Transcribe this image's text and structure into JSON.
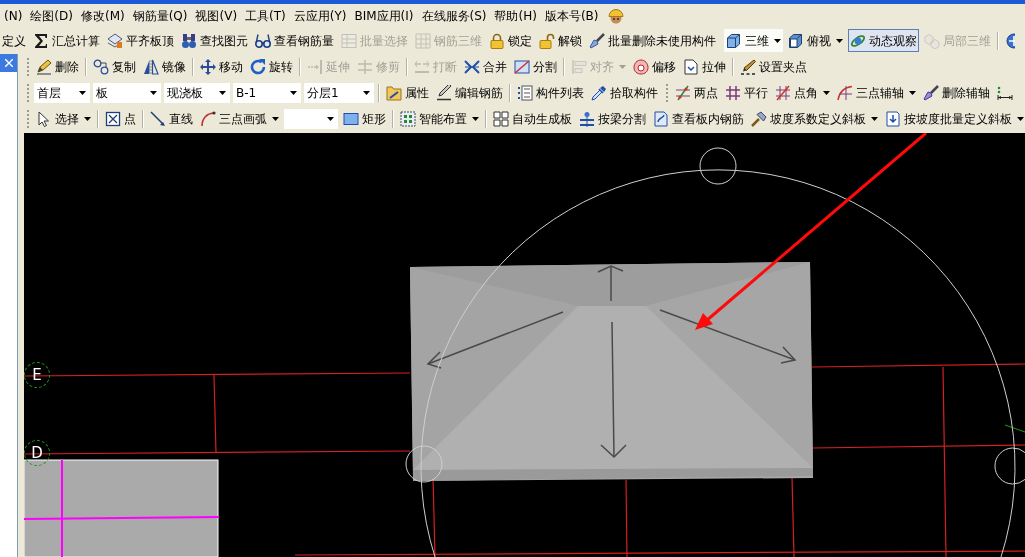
{
  "menu_bar": {
    "items": [
      "(N)",
      "绘图(D)",
      "修改(M)",
      "钢筋量(Q)",
      "视图(V)",
      "工具(T)",
      "云应用(Y)",
      "BIM应用(I)",
      "在线服务(S)",
      "帮助(H)",
      "版本号(B)"
    ]
  },
  "toolbar_rows": [
    {
      "toolbars": [
        {
          "groups": [
            {
              "items": [
                {
                  "label": "定义",
                  "kind": "button",
                  "disabled": false
                },
                {
                  "label": "汇总计算",
                  "kind": "button",
                  "disabled": false
                },
                {
                  "label": "平齐板顶",
                  "kind": "button",
                  "disabled": false
                },
                {
                  "label": "查找图元",
                  "kind": "button",
                  "disabled": false
                },
                {
                  "label": "查看钢筋量",
                  "kind": "button",
                  "disabled": false
                },
                {
                  "label": "批量选择",
                  "kind": "button",
                  "disabled": true
                },
                {
                  "label": "钢筋三维",
                  "kind": "button",
                  "disabled": true
                },
                {
                  "label": "锁定",
                  "kind": "button",
                  "disabled": false
                },
                {
                  "label": "解锁",
                  "kind": "button",
                  "disabled": false
                },
                {
                  "label": "批量删除未使用构件",
                  "kind": "button",
                  "disabled": false
                }
              ]
            }
          ]
        },
        {
          "groups": [
            {
              "items": [
                {
                  "label": "三维",
                  "kind": "split",
                  "disabled": false,
                  "selected": true
                },
                {
                  "label": "俯视",
                  "kind": "split",
                  "disabled": false,
                  "selected": false
                },
                {
                  "label": "动态观察",
                  "kind": "toggle",
                  "disabled": false,
                  "selected": true
                },
                {
                  "label": "局部三维",
                  "kind": "button",
                  "disabled": true,
                  "selected": false
                }
              ]
            },
            {
              "items": [
                {
                  "kind": "icon",
                  "disabled": false
                }
              ]
            }
          ]
        }
      ]
    },
    {
      "toolbars": [
        {
          "groups": [
            {
              "items": [
                {
                  "label": "删除",
                  "kind": "button",
                  "disabled": false
                }
              ]
            },
            {
              "items": [
                {
                  "label": "复制",
                  "kind": "button",
                  "disabled": false
                },
                {
                  "label": "镜像",
                  "kind": "button",
                  "disabled": false
                }
              ]
            },
            {
              "items": [
                {
                  "label": "移动",
                  "kind": "button",
                  "disabled": false
                },
                {
                  "label": "旋转",
                  "kind": "button",
                  "disabled": false
                }
              ]
            },
            {
              "items": [
                {
                  "label": "延伸",
                  "kind": "button",
                  "disabled": true
                },
                {
                  "label": "修剪",
                  "kind": "button",
                  "disabled": true
                }
              ]
            },
            {
              "items": [
                {
                  "label": "打断",
                  "kind": "button",
                  "disabled": true
                },
                {
                  "label": "合并",
                  "kind": "button",
                  "disabled": false
                },
                {
                  "label": "分割",
                  "kind": "button",
                  "disabled": false
                }
              ]
            },
            {
              "items": [
                {
                  "label": "对齐",
                  "kind": "split",
                  "disabled": true
                },
                {
                  "label": "偏移",
                  "kind": "button",
                  "disabled": false
                },
                {
                  "label": "拉伸",
                  "kind": "button",
                  "disabled": false
                }
              ]
            },
            {
              "items": [
                {
                  "label": "设置夹点",
                  "kind": "button",
                  "disabled": false
                }
              ]
            }
          ]
        }
      ]
    },
    {
      "toolbars": [
        {
          "groups": [
            {
              "items": [
                {
                  "value": "首层",
                  "kind": "combo",
                  "disabled": false
                },
                {
                  "value": "板",
                  "kind": "combo",
                  "disabled": false
                },
                {
                  "value": "现浇板",
                  "kind": "combo",
                  "disabled": false
                },
                {
                  "value": "B-1",
                  "kind": "combo",
                  "disabled": false
                },
                {
                  "value": "分层1",
                  "kind": "combo",
                  "disabled": false
                }
              ]
            },
            {
              "items": [
                {
                  "label": "属性",
                  "kind": "button",
                  "disabled": false
                },
                {
                  "label": "编辑钢筋",
                  "kind": "button",
                  "disabled": false
                }
              ]
            },
            {
              "items": [
                {
                  "label": "构件列表",
                  "kind": "button",
                  "disabled": false
                },
                {
                  "label": "拾取构件",
                  "kind": "button",
                  "disabled": false
                }
              ]
            }
          ]
        },
        {
          "groups": [
            {
              "items": [
                {
                  "label": "两点",
                  "kind": "button",
                  "disabled": false
                },
                {
                  "label": "平行",
                  "kind": "button",
                  "disabled": false
                },
                {
                  "label": "点角",
                  "kind": "split",
                  "disabled": false
                },
                {
                  "label": "三点辅轴",
                  "kind": "split",
                  "disabled": false
                },
                {
                  "label": "删除辅轴",
                  "kind": "button",
                  "disabled": false
                },
                {
                  "kind": "icon",
                  "disabled": false
                }
              ]
            }
          ]
        }
      ]
    },
    {
      "toolbars": [
        {
          "groups": [
            {
              "items": [
                {
                  "label": "选择",
                  "kind": "split",
                  "disabled": false
                }
              ]
            },
            {
              "items": [
                {
                  "label": "点",
                  "kind": "button",
                  "disabled": false
                }
              ]
            },
            {
              "items": [
                {
                  "label": "直线",
                  "kind": "button",
                  "disabled": false
                },
                {
                  "label": "三点画弧",
                  "kind": "split",
                  "disabled": false
                },
                {
                  "kind": "combo",
                  "disabled": false
                },
                {
                  "label": "矩形",
                  "kind": "button",
                  "disabled": false
                }
              ]
            },
            {
              "items": [
                {
                  "label": "智能布置",
                  "kind": "split",
                  "disabled": false
                }
              ]
            },
            {
              "items": [
                {
                  "label": "自动生成板",
                  "kind": "button",
                  "disabled": false
                },
                {
                  "label": "按梁分割",
                  "kind": "button",
                  "disabled": false
                },
                {
                  "label": "查看板内钢筋",
                  "kind": "button",
                  "disabled": false
                },
                {
                  "label": "坡度系数定义斜板",
                  "kind": "split",
                  "disabled": false
                },
                {
                  "label": "按坡度批量定义斜板",
                  "kind": "split",
                  "disabled": false
                }
              ]
            }
          ]
        }
      ]
    }
  ],
  "canvas": {
    "axis_labels": [
      "E",
      "D"
    ]
  }
}
